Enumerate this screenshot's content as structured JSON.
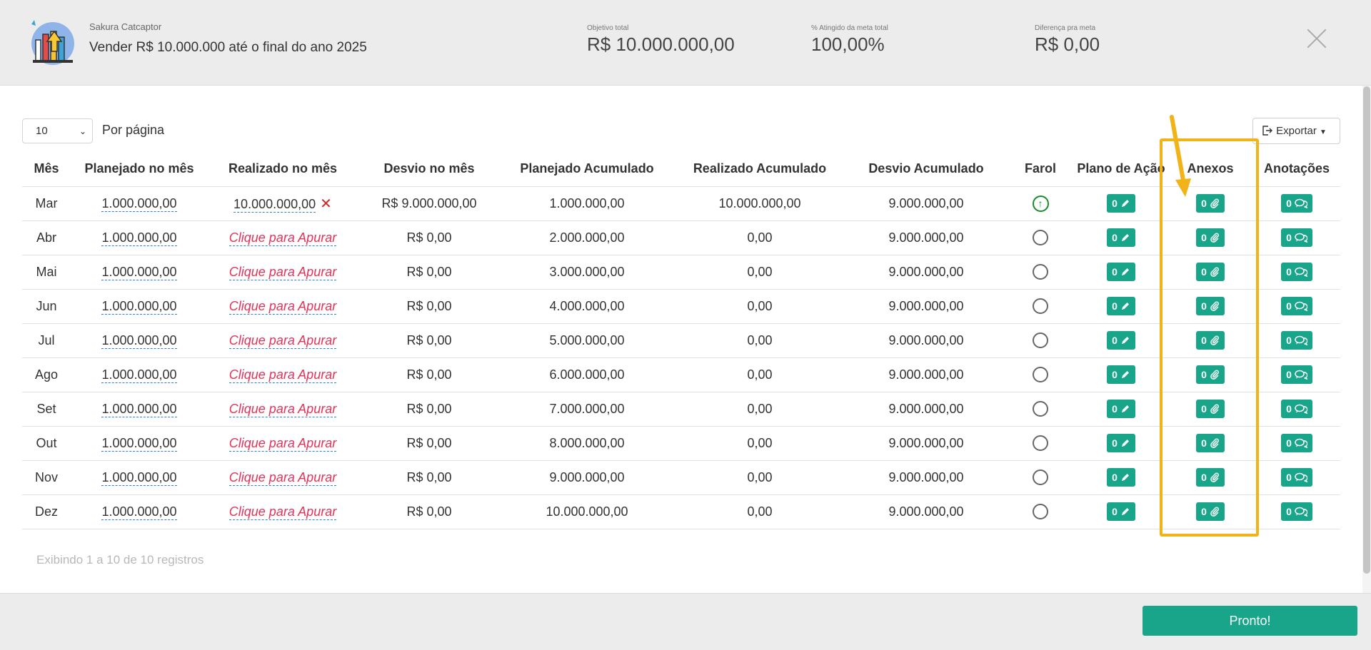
{
  "header": {
    "company": "Sakura Catcaptor",
    "goal_title": "Vender R$ 10.000.000 até o final do ano 2025",
    "stats": [
      {
        "label": "Objetivo total",
        "value": "R$ 10.000.000,00"
      },
      {
        "label": "% Atingido da meta total",
        "value": "100,00%"
      },
      {
        "label": "Diferença pra meta",
        "value": "R$ 0,00"
      }
    ]
  },
  "controls": {
    "per_page_value": "10",
    "per_page_label": "Por página",
    "export_label": "Exportar"
  },
  "table": {
    "headers": [
      "Mês",
      "Planejado no mês",
      "Realizado no mês",
      "Desvio no mês",
      "Planejado Acumulado",
      "Realizado Acumulado",
      "Desvio Acumulado",
      "Farol",
      "Plano de Ação",
      "Anexos",
      "Anotações"
    ],
    "rows": [
      {
        "month": "Mar",
        "planned": "1.000.000,00",
        "realized": "10.000.000,00",
        "deviation": "R$ 9.000.000,00",
        "planned_acc": "1.000.000,00",
        "realized_acc": "10.000.000,00",
        "deviation_acc": "9.000.000,00",
        "farol": "up",
        "plan_count": "0",
        "attach_count": "0",
        "notes_count": "0"
      },
      {
        "month": "Abr",
        "planned": "1.000.000,00",
        "realized": "Clique para Apurar",
        "deviation": "R$ 0,00",
        "planned_acc": "2.000.000,00",
        "realized_acc": "0,00",
        "deviation_acc": "9.000.000,00",
        "farol": "empty",
        "plan_count": "0",
        "attach_count": "0",
        "notes_count": "0"
      },
      {
        "month": "Mai",
        "planned": "1.000.000,00",
        "realized": "Clique para Apurar",
        "deviation": "R$ 0,00",
        "planned_acc": "3.000.000,00",
        "realized_acc": "0,00",
        "deviation_acc": "9.000.000,00",
        "farol": "empty",
        "plan_count": "0",
        "attach_count": "0",
        "notes_count": "0"
      },
      {
        "month": "Jun",
        "planned": "1.000.000,00",
        "realized": "Clique para Apurar",
        "deviation": "R$ 0,00",
        "planned_acc": "4.000.000,00",
        "realized_acc": "0,00",
        "deviation_acc": "9.000.000,00",
        "farol": "empty",
        "plan_count": "0",
        "attach_count": "0",
        "notes_count": "0"
      },
      {
        "month": "Jul",
        "planned": "1.000.000,00",
        "realized": "Clique para Apurar",
        "deviation": "R$ 0,00",
        "planned_acc": "5.000.000,00",
        "realized_acc": "0,00",
        "deviation_acc": "9.000.000,00",
        "farol": "empty",
        "plan_count": "0",
        "attach_count": "0",
        "notes_count": "0"
      },
      {
        "month": "Ago",
        "planned": "1.000.000,00",
        "realized": "Clique para Apurar",
        "deviation": "R$ 0,00",
        "planned_acc": "6.000.000,00",
        "realized_acc": "0,00",
        "deviation_acc": "9.000.000,00",
        "farol": "empty",
        "plan_count": "0",
        "attach_count": "0",
        "notes_count": "0"
      },
      {
        "month": "Set",
        "planned": "1.000.000,00",
        "realized": "Clique para Apurar",
        "deviation": "R$ 0,00",
        "planned_acc": "7.000.000,00",
        "realized_acc": "0,00",
        "deviation_acc": "9.000.000,00",
        "farol": "empty",
        "plan_count": "0",
        "attach_count": "0",
        "notes_count": "0"
      },
      {
        "month": "Out",
        "planned": "1.000.000,00",
        "realized": "Clique para Apurar",
        "deviation": "R$ 0,00",
        "planned_acc": "8.000.000,00",
        "realized_acc": "0,00",
        "deviation_acc": "9.000.000,00",
        "farol": "empty",
        "plan_count": "0",
        "attach_count": "0",
        "notes_count": "0"
      },
      {
        "month": "Nov",
        "planned": "1.000.000,00",
        "realized": "Clique para Apurar",
        "deviation": "R$ 0,00",
        "planned_acc": "9.000.000,00",
        "realized_acc": "0,00",
        "deviation_acc": "9.000.000,00",
        "farol": "empty",
        "plan_count": "0",
        "attach_count": "0",
        "notes_count": "0"
      },
      {
        "month": "Dez",
        "planned": "1.000.000,00",
        "realized": "Clique para Apurar",
        "deviation": "R$ 0,00",
        "planned_acc": "10.000.000,00",
        "realized_acc": "0,00",
        "deviation_acc": "9.000.000,00",
        "farol": "empty",
        "plan_count": "0",
        "attach_count": "0",
        "notes_count": "0"
      }
    ]
  },
  "info": "Exibindo 1 a 10 de 10 registros",
  "footer": {
    "ready_label": "Pronto!"
  },
  "colors": {
    "accent": "#19a58a",
    "link_red": "#e8305a",
    "highlight": "#f2b318",
    "farol_green": "#1a8a2a"
  }
}
